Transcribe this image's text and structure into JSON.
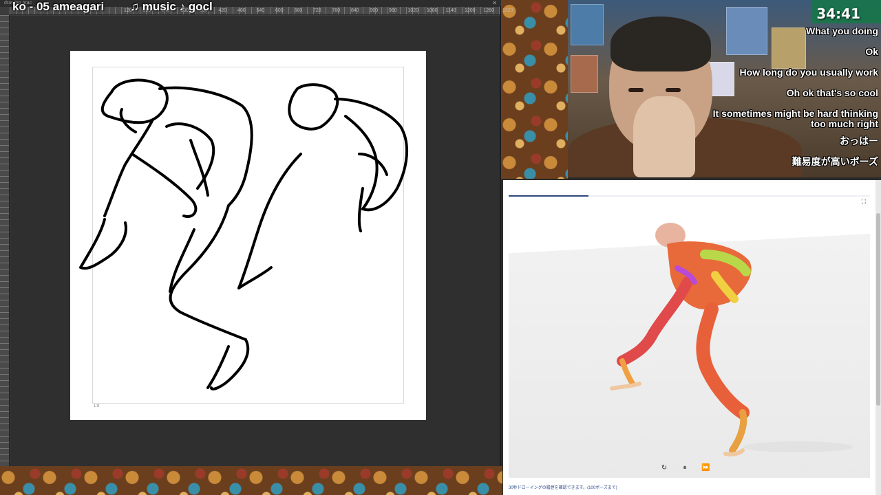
{
  "stream_title": {
    "artist_track": "ko - 05 ameagari",
    "music": "♫ music ♪ gocl"
  },
  "drawing_app": {
    "tab_label": "drawing prac",
    "close_icon": "close-icon",
    "ruler_ticks": [
      "120",
      "180",
      "240",
      "300",
      "360",
      "420",
      "480",
      "540",
      "600",
      "660",
      "720",
      "780",
      "840",
      "900",
      "960",
      "1020",
      "1080",
      "1140",
      "1200",
      "1260",
      "1320"
    ],
    "paper_note": "1:8"
  },
  "webcam": {
    "timer": "34:41",
    "chat_messages": [
      "What you doing",
      "Ok",
      "How long do you usually work",
      "Oh ok that's so cool",
      "It sometimes might be hard thinking too much right",
      "おっはー",
      "難易度が高いポーズ"
    ]
  },
  "pose_viewer": {
    "progress_fraction": 0.22,
    "fullscreen_icon": "fullscreen-icon",
    "controls": [
      {
        "name": "replay",
        "icon": "replay-icon",
        "glyph": "↻"
      },
      {
        "name": "pause",
        "icon": "pause-icon",
        "glyph": "⏸"
      },
      {
        "name": "skip",
        "icon": "skip-forward-icon",
        "glyph": "⏩"
      }
    ],
    "caption": "30秒ドローイングの履歴を確認できます。(100ポーズまで)"
  }
}
